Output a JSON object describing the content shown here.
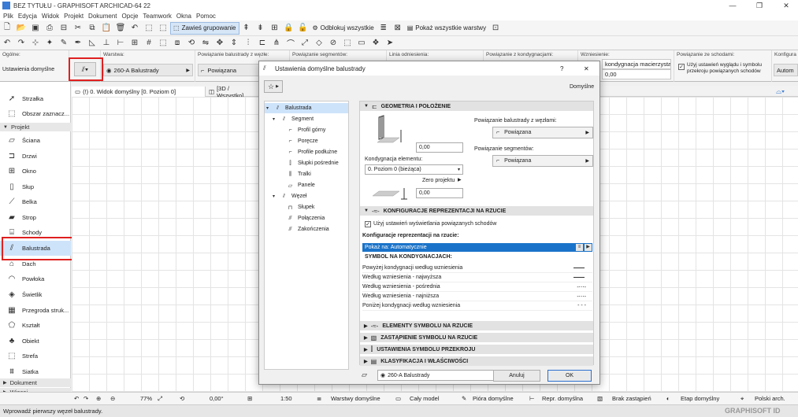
{
  "app": {
    "title": "BEZ TYTUŁU - GRAPHISOFT ARCHICAD-64 22",
    "brand": "GRAPHISOFT ID"
  },
  "menu": [
    "Plik",
    "Edycja",
    "Widok",
    "Projekt",
    "Dokument",
    "Opcje",
    "Teamwork",
    "Okna",
    "Pomoc"
  ],
  "toolbar": {
    "suspend_groups": "Zawieś grupowanie",
    "unlock_all": "Odblokuj wszystkie",
    "show_all_layers": "Pokaż wszystkie warstwy"
  },
  "infobox": {
    "general_label": "Ogólne:",
    "default_settings_label": "Ustawienia domyślne",
    "layer_label": "Warstwa:",
    "layer_value": "260-A Balustrady",
    "railing_link_label": "Powiązanie balustrady z węzłe:",
    "segments_link_label": "Powiązanie segmentów:",
    "ref_line_label": "Linia odniesienia:",
    "story_link_label": "Powiązanie z kondygnacjami:",
    "rise_label": "Wzniesienie:",
    "stair_link_label": "Powiązanie ze schodami:",
    "config_label": "Konfigura",
    "linked_value": "Powiązana",
    "parent_story_value": "kondygnacja macierzysta",
    "offset_value": "0,00",
    "use_stair_display": "Użyj ustawień wyglądu i symbolu przekroju powiązanych schodów",
    "auto_value": "Autom"
  },
  "toolbox": {
    "arrow": "Strzałka",
    "marquee": "Obszar zaznacz...",
    "group_design": "Projekt",
    "tools": [
      "Ściana",
      "Drzwi",
      "Okno",
      "Słup",
      "Belka",
      "Strop",
      "Schody",
      "Balustrada",
      "Dach",
      "Powłoka",
      "Świetlik",
      "Przegroda struk...",
      "Kształt",
      "Obiekt",
      "Strefa",
      "Siatka"
    ],
    "group_document": "Dokument",
    "group_more": "Więcej"
  },
  "tabs": {
    "tab1": "(!) 0. Widok domyślny [0. Poziom 0]",
    "tab2": "[3D / Wszystko]"
  },
  "statusbar": {
    "zoom": "77%",
    "angle": "0,00°",
    "scale": "1:50",
    "layers": "Warstwy domyślne",
    "model": "Cały model",
    "pens": "Pióra domyślne",
    "repr": "Repr. domyślna",
    "override": "Brak zastąpień",
    "phase": "Etap domyślny",
    "lang": "Polski arch.",
    "prompt": "Wprowadź pierwszy węzeł balustrady."
  },
  "dialog": {
    "title": "Ustawienia domyślne balustrady",
    "help": "?",
    "close": "✕",
    "defaults_label": "Domyślne",
    "tree": [
      {
        "label": "Balustrada",
        "level": 0,
        "toggle": "▾",
        "selected": true
      },
      {
        "label": "Segment",
        "level": 1,
        "toggle": "▾"
      },
      {
        "label": "Profil górny",
        "level": 2
      },
      {
        "label": "Poręcze",
        "level": 2
      },
      {
        "label": "Profile podłużne",
        "level": 2
      },
      {
        "label": "Słupki pośrednie",
        "level": 2
      },
      {
        "label": "Tralki",
        "level": 2
      },
      {
        "label": "Panele",
        "level": 2
      },
      {
        "label": "Węzeł",
        "level": 1,
        "toggle": "▾"
      },
      {
        "label": "Słupek",
        "level": 2
      },
      {
        "label": "Połączenia",
        "level": 2
      },
      {
        "label": "Zakończenia",
        "level": 2
      }
    ],
    "geometry": {
      "header": "GEOMETRIA I POŁOŻENIE",
      "top_value": "0,00",
      "story_label": "Kondygnacja elementu:",
      "story_value": "0. Poziom 0 (bieżąca)",
      "zero_label": "Zero projektu",
      "bottom_value": "0,00",
      "node_link_label": "Powiązanie balustrady z węzłami:",
      "node_link_value": "Powiązana",
      "seg_link_label": "Powiązanie segmentów:",
      "seg_link_value": "Powiązana"
    },
    "floorplan": {
      "header": "KONFIGURACJE REPREZENTACJI NA RZUCIE",
      "use_stair_label": "Użyj ustawień wyświetlania powiązanych schodów",
      "configs_label": "Konfiguracje reprezentacji na rzucie:",
      "show_on": "Pokaż na: Automatycznie",
      "symbol_header": "SYMBOL NA KONDYGNACJACH:",
      "rows": [
        "Powyżej kondygnacji według wzniesienia",
        "Według wzniesienia - najwyższa",
        "Według wzniesienia - pośrednia",
        "Według wzniesienia - najniższa",
        "Poniżej kondygnacji według wzniesienia"
      ]
    },
    "collapsed_sections": [
      "ELEMENTY SYMBOLU NA RZUCIE",
      "ZASTĄPIENIE SYMBOLU NA RZUCIE",
      "USTAWIENIA SYMBOLU PRZEKROJU",
      "KLASYFIKACJA I WŁAŚCIWOŚCI"
    ],
    "footer_layer": "260-A Balustrady",
    "cancel": "Anuluj",
    "ok": "OK"
  }
}
